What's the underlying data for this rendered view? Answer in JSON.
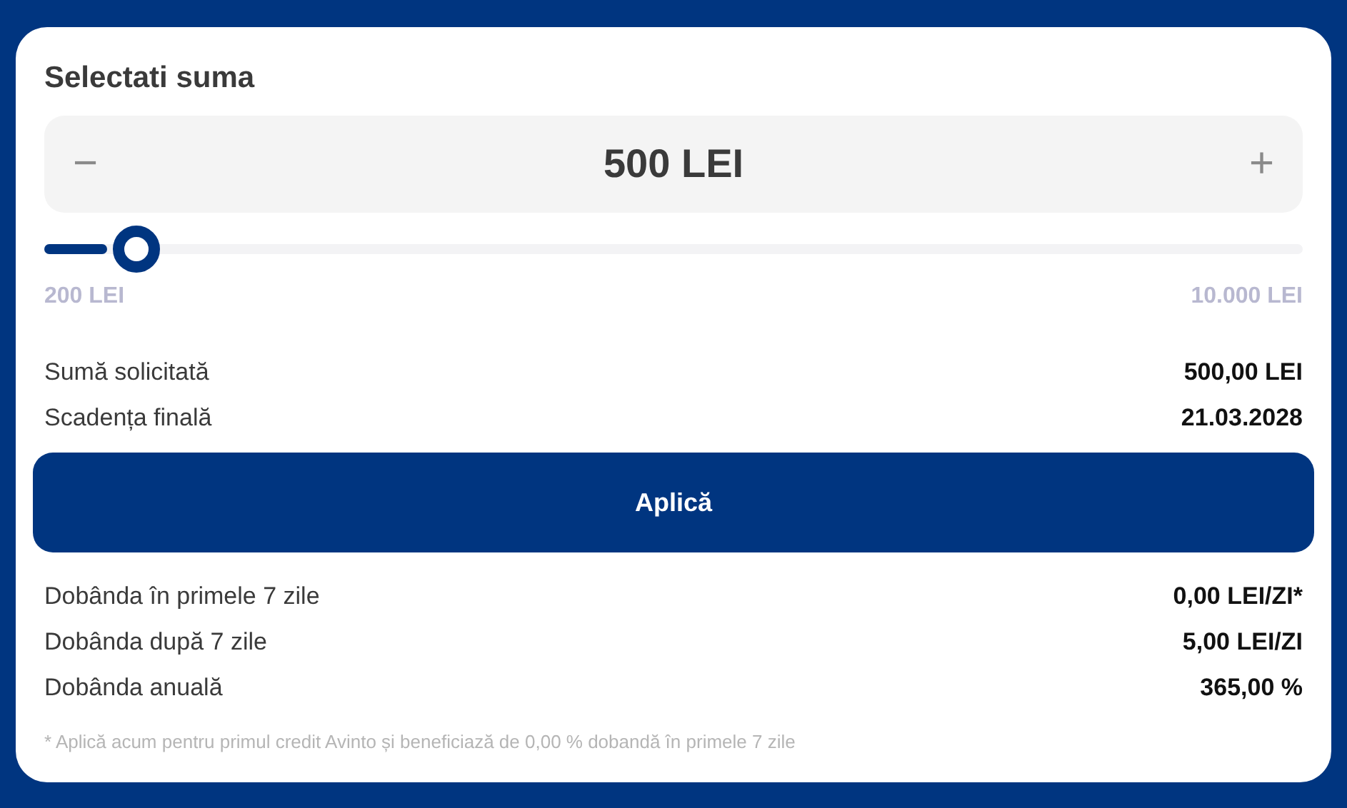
{
  "title": "Selectati suma",
  "amount": {
    "value": "500 LEI",
    "minus": "−",
    "plus": "+"
  },
  "slider": {
    "level": 0.05,
    "min_label": "200 LEI",
    "max_label": "10.000 LEI"
  },
  "summary": [
    {
      "label": "Sumă solicitată",
      "value": "500,00 LEI"
    },
    {
      "label": "Scadența finală",
      "value": "21.03.2028"
    }
  ],
  "apply_button": "Aplică",
  "interest": [
    {
      "label": "Dobânda în primele 7 zile",
      "value": "0,00 LEI/ZI*"
    },
    {
      "label": "Dobânda după 7 zile",
      "value": "5,00 LEI/ZI"
    },
    {
      "label": "Dobânda anuală",
      "value": "365,00 %"
    }
  ],
  "footnote": "* Aplică acum pentru primul credit Avinto și beneficiază de 0,00 % dobandă în primele 7 zile"
}
